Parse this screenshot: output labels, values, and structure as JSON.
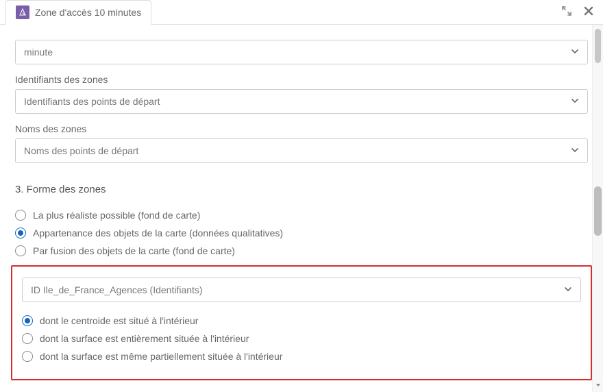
{
  "header": {
    "title": "Zone d'accès 10 minutes"
  },
  "fields": {
    "unit": {
      "value": "minute"
    },
    "zone_ids": {
      "label": "Identifiants des zones",
      "value": "Identifiants des points de départ"
    },
    "zone_names": {
      "label": "Noms des zones",
      "value": "Noms des points de départ"
    }
  },
  "section3": {
    "title": "3. Forme des zones",
    "shape_options": [
      {
        "label": "La plus réaliste possible (fond de carte)",
        "selected": false
      },
      {
        "label": "Appartenance des objets de la carte (données qualitatives)",
        "selected": true
      },
      {
        "label": "Par fusion des objets de la carte (fond de carte)",
        "selected": false
      }
    ],
    "layer_select": {
      "value": "ID Ile_de_France_Agences (Identifiants)"
    },
    "containment_options": [
      {
        "label": "dont le centroide est situé à l'intérieur",
        "selected": true
      },
      {
        "label": "dont la surface est entièrement située à l'intérieur",
        "selected": false
      },
      {
        "label": "dont la surface est même partiellement située à l'intérieur",
        "selected": false
      }
    ]
  }
}
